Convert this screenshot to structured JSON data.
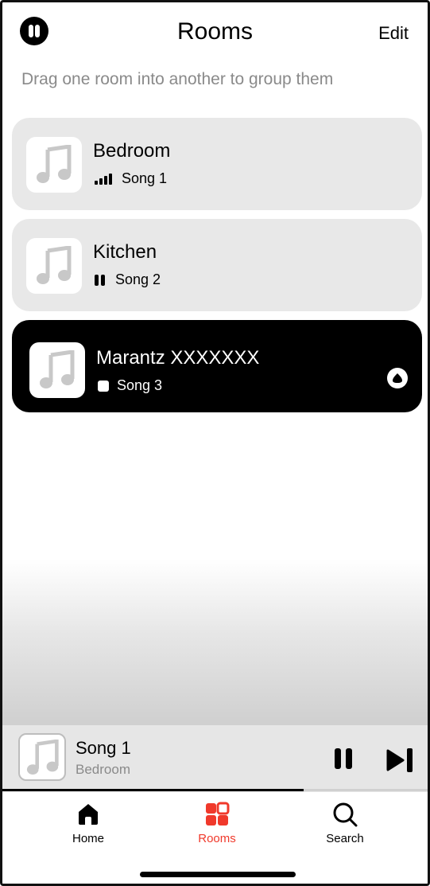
{
  "header": {
    "title": "Rooms",
    "edit_label": "Edit",
    "left_icon": "pause-circle-icon"
  },
  "subtitle": "Drag one room into another to group them",
  "rooms": [
    {
      "name": "Bedroom",
      "song": "Song 1",
      "status_icon": "signal-bars-icon",
      "selected": false
    },
    {
      "name": "Kitchen",
      "song": "Song 2",
      "status_icon": "pause-icon",
      "selected": false
    },
    {
      "name": "Marantz XXXXXXX",
      "song": "Song 3",
      "status_icon": "stop-icon",
      "selected": true,
      "action_icon": "expand-icon"
    }
  ],
  "now_playing": {
    "title": "Song 1",
    "room": "Bedroom",
    "progress": 0.7
  },
  "tabs": [
    {
      "label": "Home",
      "icon": "home-icon",
      "active": false
    },
    {
      "label": "Rooms",
      "icon": "rooms-grid-icon",
      "active": true
    },
    {
      "label": "Search",
      "icon": "search-icon",
      "active": false
    }
  ],
  "colors": {
    "accent": "#f0392b",
    "card_background": "#e8e8e8",
    "selected_card": "#000000",
    "secondary_text": "#8a8a8a"
  }
}
